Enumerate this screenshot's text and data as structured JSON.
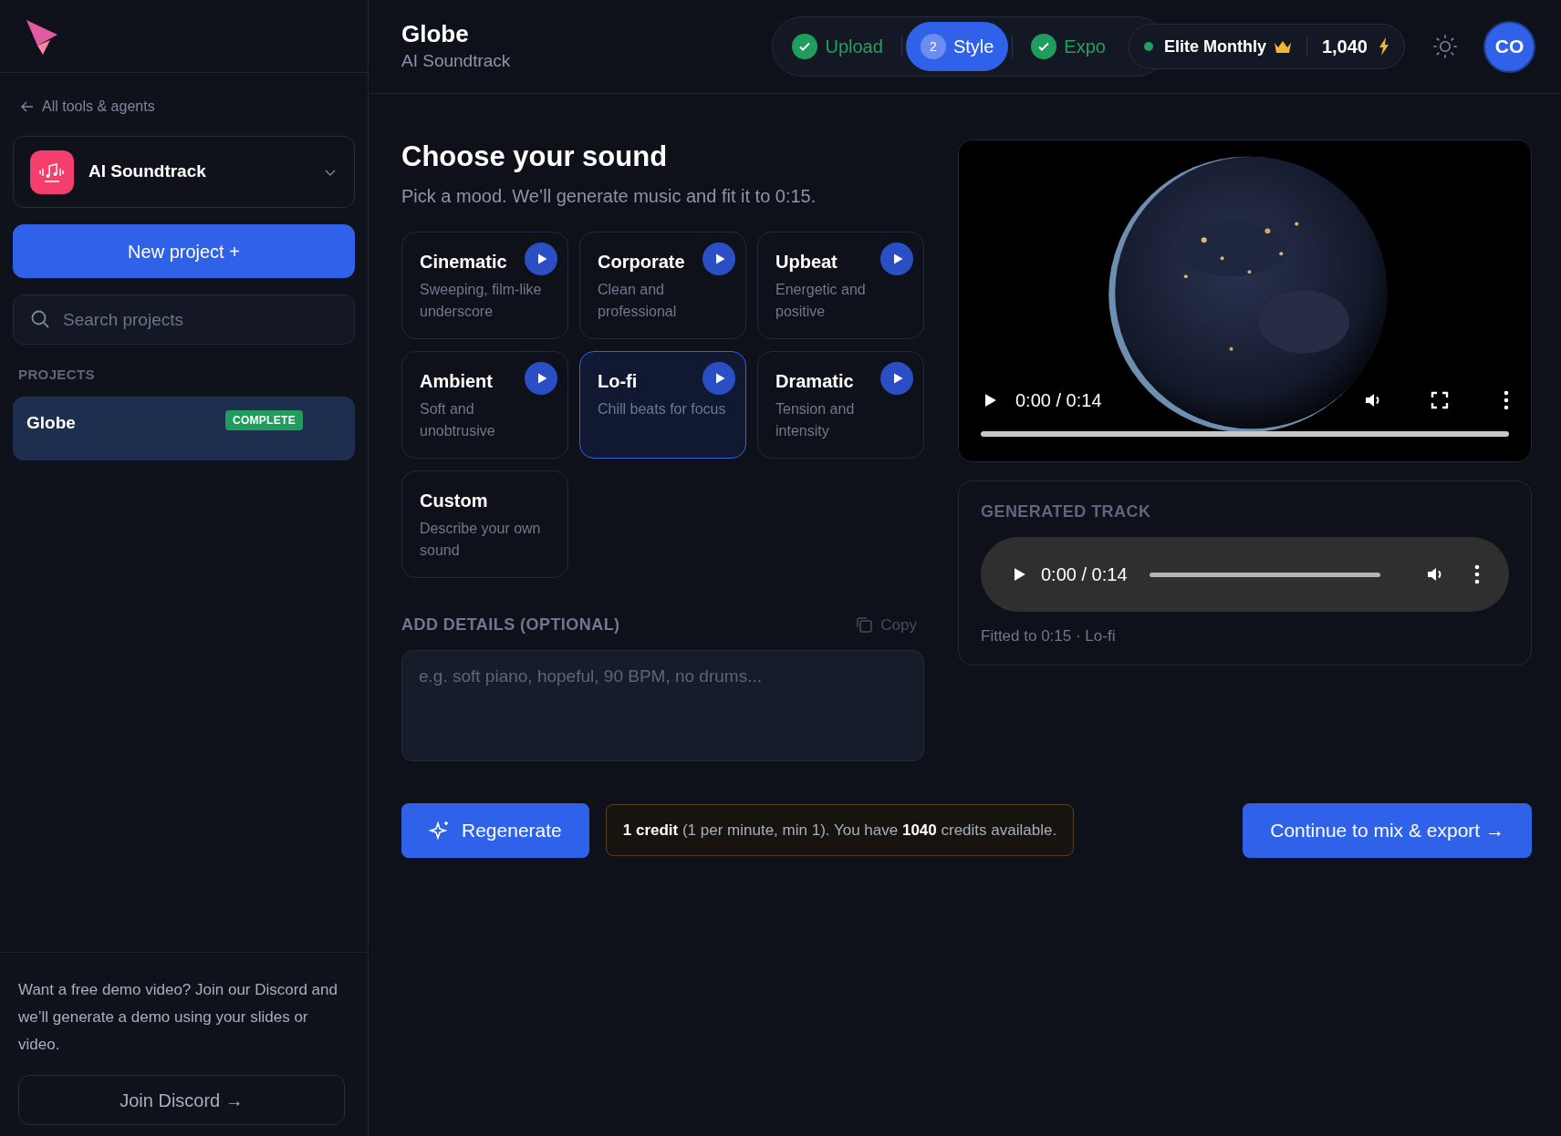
{
  "sidebar": {
    "back_link": "All tools & agents",
    "tool_selector": {
      "name": "AI Soundtrack"
    },
    "new_project_button": "New project +",
    "search": {
      "placeholder": "Search projects"
    },
    "projects_heading": "PROJECTS",
    "projects": [
      {
        "name": "Globe",
        "badge": "COMPLETE",
        "selected": true
      }
    ],
    "promo": {
      "text": "Want a free demo video? Join our Discord and we’ll generate a demo using your slides or video.",
      "button": "Join Discord →"
    }
  },
  "header": {
    "title": "Globe",
    "subtitle": "AI Soundtrack",
    "steps": [
      {
        "label": "Upload",
        "kind": "done",
        "selected": false
      },
      {
        "number": "2",
        "label": "Style",
        "kind": "current",
        "selected": true
      },
      {
        "label": "Expo",
        "kind": "done",
        "selected": false
      }
    ],
    "plan": {
      "name": "Elite Monthly",
      "credits": "1,040"
    },
    "avatar": "CO"
  },
  "main": {
    "title": "Choose your sound",
    "subtitle": "Pick a mood. We’ll generate music and fit it to 0:15.",
    "moods": [
      {
        "title": "Cinematic",
        "description": "Sweeping, film-like underscore",
        "kind": "preset",
        "selected": false
      },
      {
        "title": "Corporate",
        "description": "Clean and professional",
        "kind": "preset",
        "selected": false
      },
      {
        "title": "Upbeat",
        "description": "Energetic and positive",
        "kind": "preset",
        "selected": false
      },
      {
        "title": "Ambient",
        "description": "Soft and unobtrusive",
        "kind": "preset",
        "selected": false
      },
      {
        "title": "Lo-fi",
        "description": "Chill beats for focus",
        "kind": "preset",
        "selected": true
      },
      {
        "title": "Dramatic",
        "description": "Tension and intensity",
        "kind": "preset",
        "selected": false
      },
      {
        "title": "Custom",
        "description": "Describe your own sound",
        "kind": "custom",
        "selected": false
      }
    ],
    "details": {
      "label": "ADD DETAILS (OPTIONAL)",
      "copy_button": "Copy",
      "placeholder": "e.g. soft piano, hopeful, 90 BPM, no drums..."
    },
    "actions": {
      "regenerate": "Regenerate",
      "credit_note": "**1 credit** (1 per minute, min 1). You have **1040** credits available.",
      "continue": "Continue to mix & export →"
    }
  },
  "preview": {
    "video": {
      "time": "0:00 / 0:14"
    },
    "generated_track": {
      "heading": "GENERATED TRACK",
      "time": "0:00 / 0:14",
      "caption": "Fitted to 0:15 · Lo-fi"
    }
  }
}
